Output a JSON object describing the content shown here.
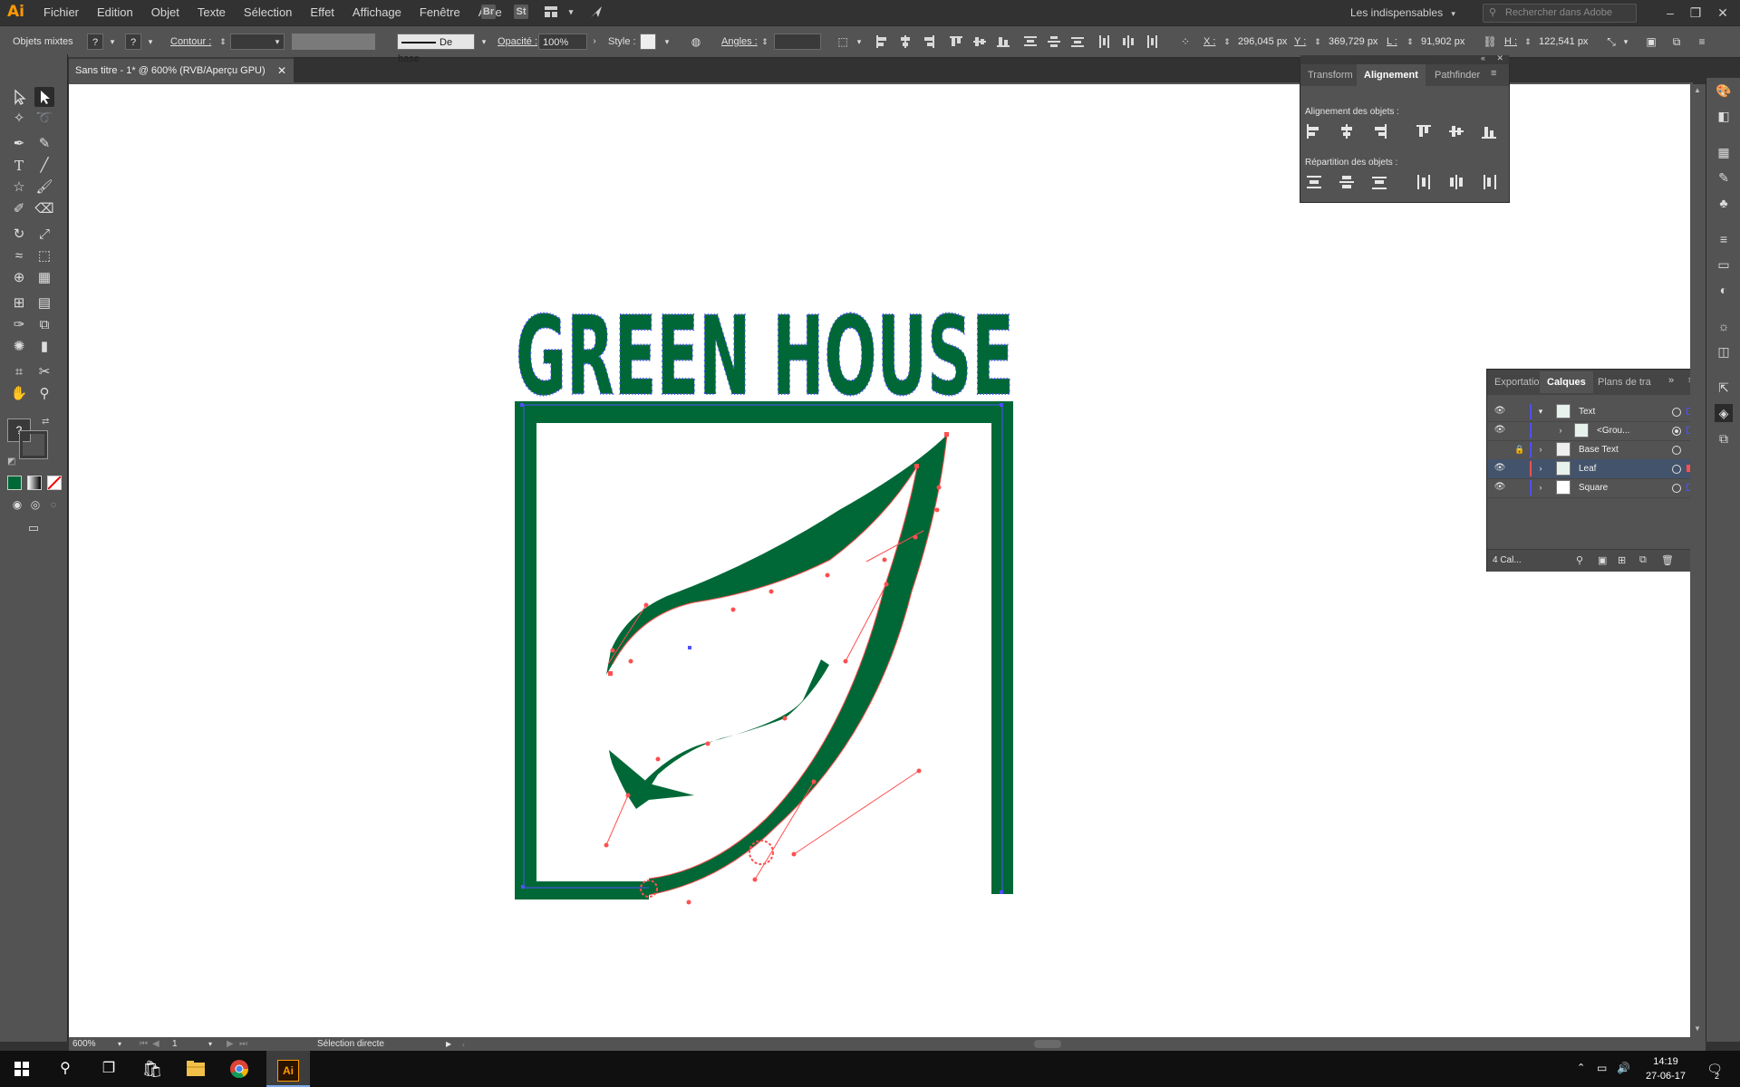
{
  "app": {
    "logo": "Ai",
    "menu": [
      "Fichier",
      "Edition",
      "Objet",
      "Texte",
      "Sélection",
      "Effet",
      "Affichage",
      "Fenêtre",
      "Aide"
    ],
    "bridge_label": "Br",
    "stock_label": "St",
    "workspace": "Les indispensables",
    "stock_search_placeholder": "Rechercher dans Adobe Stock"
  },
  "control_bar": {
    "selection_type": "Objets mixtes",
    "fill_label": "?",
    "stroke_label": "?",
    "contour_label": "Contour :",
    "brush": "De base",
    "opacity_label": "Opacité :",
    "opacity_value": "100%",
    "style_label": "Style :",
    "angles_label": "Angles :",
    "x_label": "X :",
    "x_value": "296,045 px",
    "y_label": "Y :",
    "y_value": "369,729 px",
    "w_label": "L :",
    "w_value": "91,902 px",
    "h_label": "H :",
    "h_value": "122,541 px"
  },
  "document": {
    "tab_title": "Sans titre - 1* @ 600% (RVB/Aperçu GPU)",
    "artwork_text": "GREEN HOUSE",
    "art_color": "#006837"
  },
  "align_panel": {
    "tabs": [
      "Transform",
      "Alignement",
      "Pathfinder"
    ],
    "active_tab": "Alignement",
    "section_align": "Alignement des objets :",
    "section_distribute": "Répartition des objets :"
  },
  "layers_panel": {
    "tabs": [
      "Exportation",
      "Calques",
      "Plans de tra"
    ],
    "active_tab": "Calques",
    "rows": [
      {
        "name": "Text",
        "color": "#4f4fff",
        "expanded": true,
        "visible": true,
        "locked": false
      },
      {
        "name": "<Grou...",
        "color": "#4f4fff",
        "expanded": false,
        "visible": true,
        "locked": false,
        "sublayer": true
      },
      {
        "name": "Base Text",
        "color": "#4f4fff",
        "expanded": false,
        "visible": false,
        "locked": true
      },
      {
        "name": "Leaf",
        "color": "#ff4f4f",
        "expanded": false,
        "visible": true,
        "locked": false,
        "selected": true
      },
      {
        "name": "Square",
        "color": "#4f4fff",
        "expanded": false,
        "visible": true,
        "locked": false
      }
    ],
    "footer_count": "4 Cal..."
  },
  "status_bar": {
    "zoom": "600%",
    "artboard": "1",
    "tool": "Sélection directe"
  },
  "taskbar": {
    "time": "14:19",
    "date": "27-06-17",
    "notification_count": "2"
  }
}
